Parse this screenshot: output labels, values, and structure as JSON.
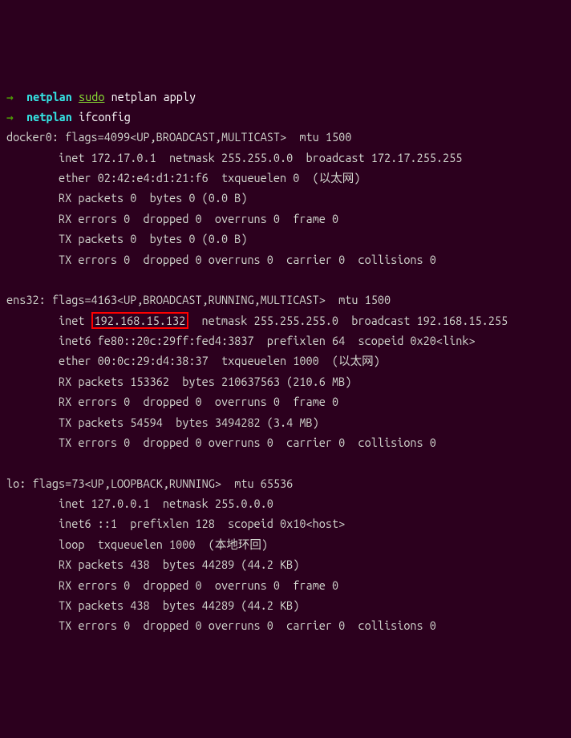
{
  "prompt1": {
    "arrow": "→",
    "ctx": "netplan",
    "sudo": "sudo",
    "rest": "netplan apply"
  },
  "prompt2": {
    "arrow": "→",
    "ctx": "netplan",
    "cmd": "ifconfig"
  },
  "docker0": {
    "header": "docker0: flags=4099<UP,BROADCAST,MULTICAST>  mtu 1500",
    "inet": "        inet 172.17.0.1  netmask 255.255.0.0  broadcast 172.17.255.255",
    "ether": "        ether 02:42:e4:d1:21:f6  txqueuelen 0  (以太网)",
    "rxp": "        RX packets 0  bytes 0 (0.0 B)",
    "rxe": "        RX errors 0  dropped 0  overruns 0  frame 0",
    "txp": "        TX packets 0  bytes 0 (0.0 B)",
    "txe": "        TX errors 0  dropped 0 overruns 0  carrier 0  collisions 0"
  },
  "ens32": {
    "header": "ens32: flags=4163<UP,BROADCAST,RUNNING,MULTICAST>  mtu 1500",
    "inet_pre": "        inet ",
    "inet_ip": "192.168.15.132",
    "inet_post": "  netmask 255.255.255.0  broadcast 192.168.15.255",
    "inet6": "        inet6 fe80::20c:29ff:fed4:3837  prefixlen 64  scopeid 0x20<link>",
    "ether": "        ether 00:0c:29:d4:38:37  txqueuelen 1000  (以太网)",
    "rxp": "        RX packets 153362  bytes 210637563 (210.6 MB)",
    "rxe": "        RX errors 0  dropped 0  overruns 0  frame 0",
    "txp": "        TX packets 54594  bytes 3494282 (3.4 MB)",
    "txe": "        TX errors 0  dropped 0 overruns 0  carrier 0  collisions 0"
  },
  "lo": {
    "header": "lo: flags=73<UP,LOOPBACK,RUNNING>  mtu 65536",
    "inet": "        inet 127.0.0.1  netmask 255.0.0.0",
    "inet6": "        inet6 ::1  prefixlen 128  scopeid 0x10<host>",
    "loop": "        loop  txqueuelen 1000  (本地环回)",
    "rxp": "        RX packets 438  bytes 44289 (44.2 KB)",
    "rxe": "        RX errors 0  dropped 0  overruns 0  frame 0",
    "txp": "        TX packets 438  bytes 44289 (44.2 KB)",
    "txe": "        TX errors 0  dropped 0 overruns 0  carrier 0  collisions 0"
  }
}
